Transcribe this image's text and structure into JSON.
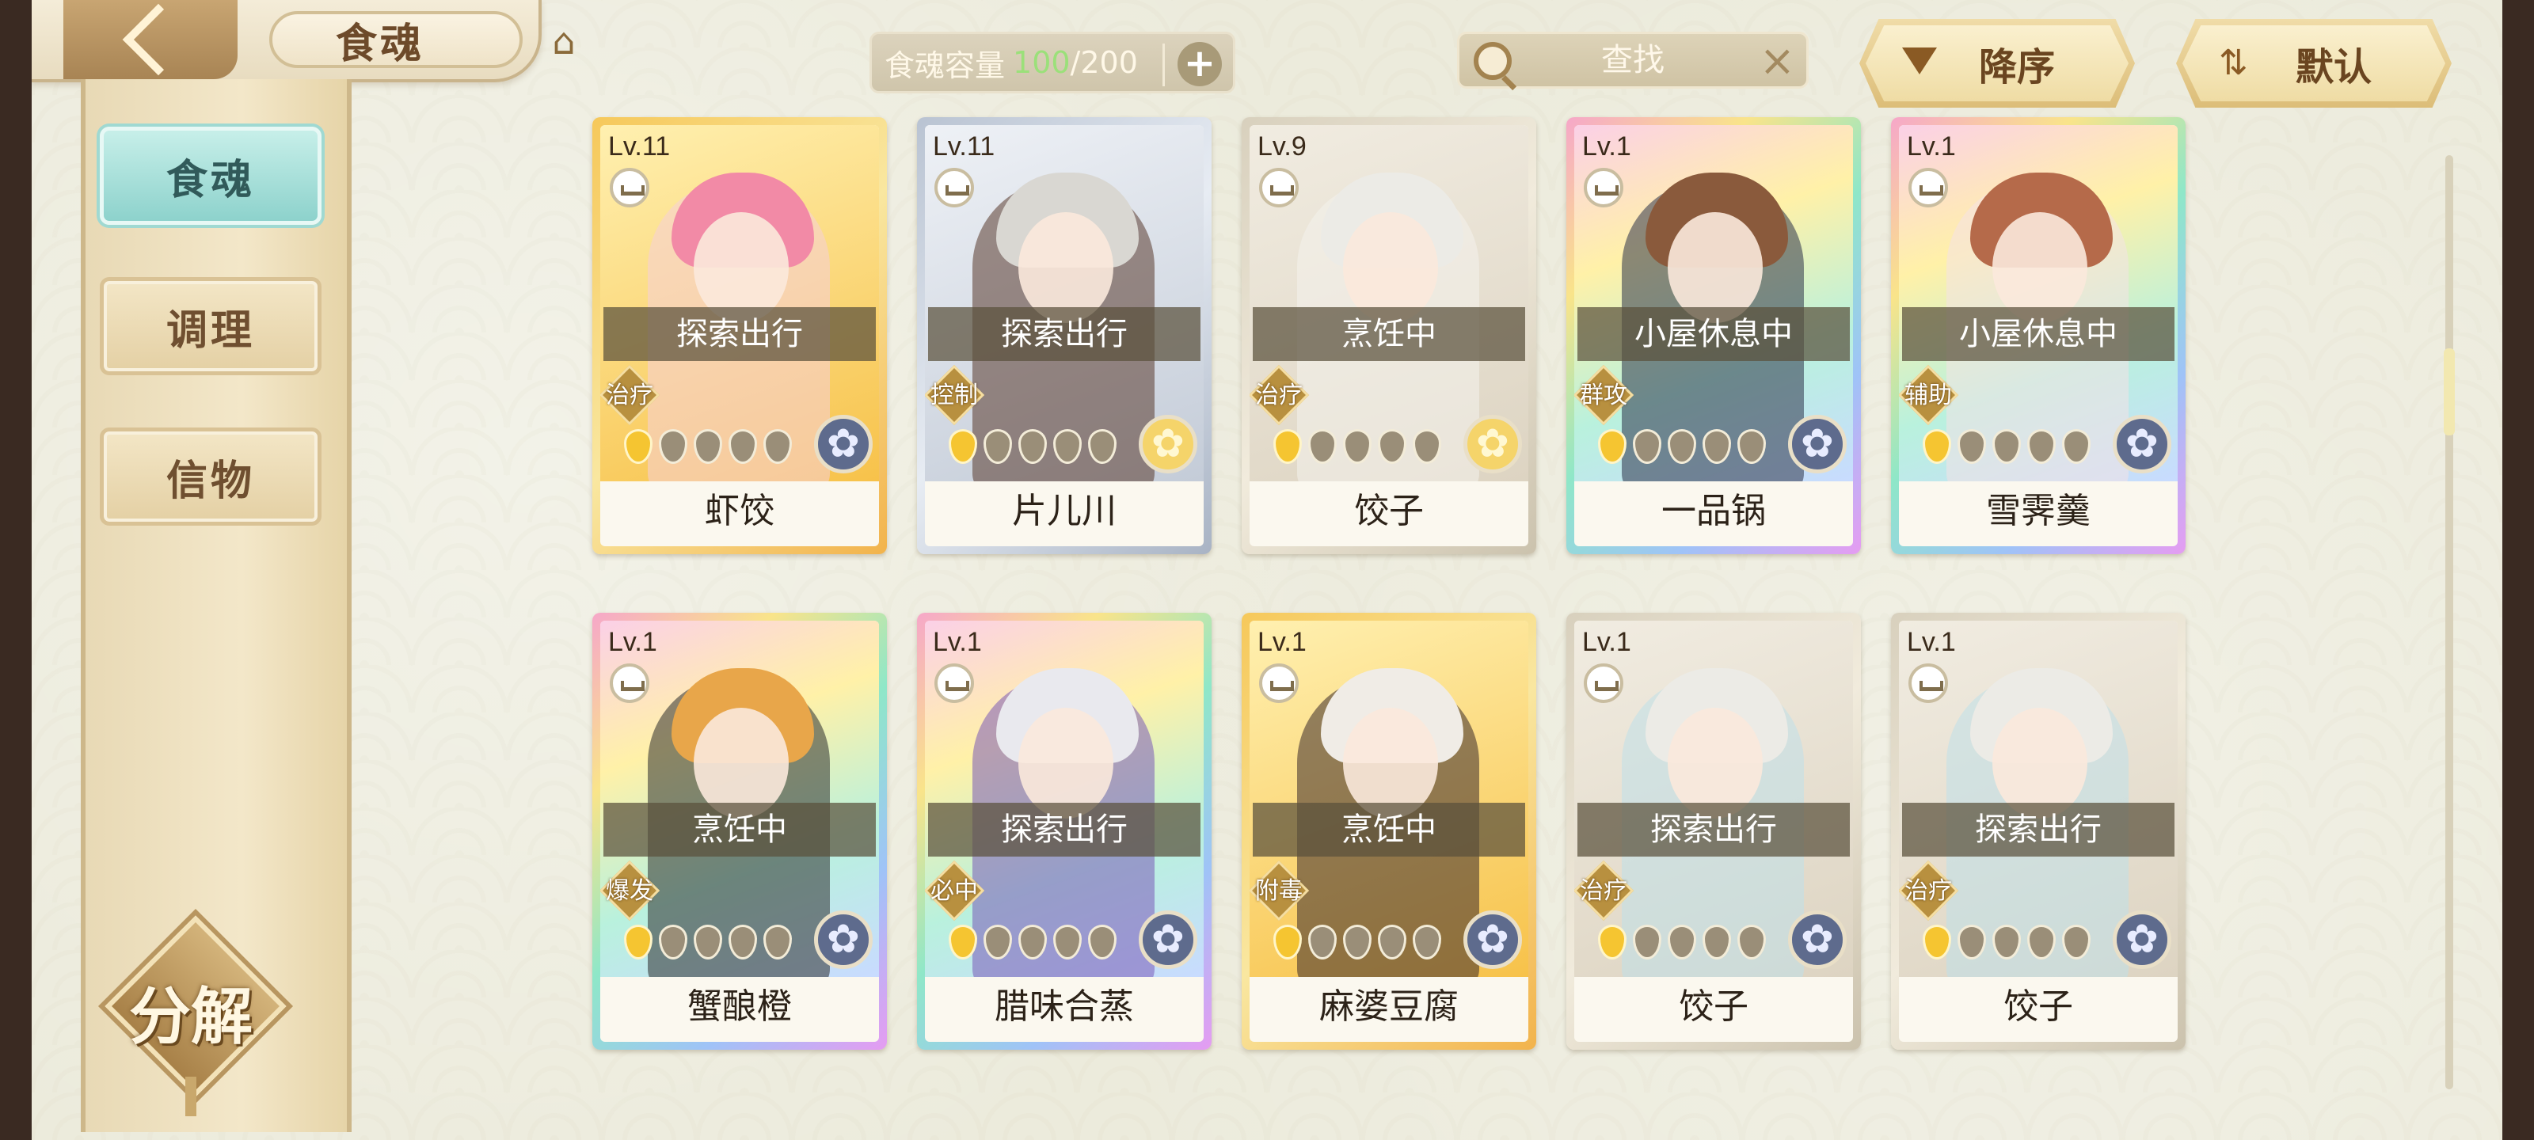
{
  "header": {
    "title": "食魂",
    "capacity_label": "食魂容量",
    "capacity_current": "100",
    "capacity_separator": "/",
    "capacity_max": "200",
    "search_label": "查找",
    "sort_order_label": "降序",
    "sort_mode_label": "默认"
  },
  "sidebar": {
    "items": [
      {
        "label": "食魂",
        "active": true
      },
      {
        "label": "调理",
        "active": false
      },
      {
        "label": "信物",
        "active": false
      }
    ],
    "decompose_label": "分解"
  },
  "cards": [
    {
      "level": "Lv.11",
      "status": "探索出行",
      "role": "治疗",
      "name": "虾饺",
      "stars": 1,
      "emblem": "blue",
      "frame": "gold",
      "hair": "#f28aa6",
      "outfit": "#f5d0d8"
    },
    {
      "level": "Lv.11",
      "status": "探索出行",
      "role": "控制",
      "name": "片儿川",
      "stars": 1,
      "emblem": "gold",
      "frame": "silver",
      "hair": "#d9d7d2",
      "outfit": "#5a3a2e"
    },
    {
      "level": "Lv.9",
      "status": "烹饪中",
      "role": "治疗",
      "name": "饺子",
      "stars": 1,
      "emblem": "gold",
      "frame": "plain",
      "hair": "#ecebe6",
      "outfit": "#f4f2ec"
    },
    {
      "level": "Lv.1",
      "status": "小屋休息中",
      "role": "群攻",
      "name": "一品锅",
      "stars": 1,
      "emblem": "blue",
      "frame": "rainbow",
      "hair": "#8a5a3c",
      "outfit": "#2c3248"
    },
    {
      "level": "Lv.1",
      "status": "小屋休息中",
      "role": "辅助",
      "name": "雪霁羹",
      "stars": 1,
      "emblem": "blue",
      "frame": "rainbow",
      "hair": "#b56a4a",
      "outfit": "#f4e2e6"
    },
    {
      "level": "Lv.1",
      "status": "烹饪中",
      "role": "爆发",
      "name": "蟹酿橙",
      "stars": 1,
      "emblem": "blue",
      "frame": "rainbow",
      "hair": "#e8a64a",
      "outfit": "#2b2b2b"
    },
    {
      "level": "Lv.1",
      "status": "探索出行",
      "role": "必中",
      "name": "腊味合蒸",
      "stars": 1,
      "emblem": "blue",
      "frame": "rainbow",
      "hair": "#e9e9ee",
      "outfit": "#7a5ab8"
    },
    {
      "level": "Lv.1",
      "status": "烹饪中",
      "role": "附毒",
      "name": "麻婆豆腐",
      "stars": 1,
      "emblem": "blue",
      "frame": "gold",
      "hair": "#f0ece6",
      "outfit": "#3a2a2a"
    },
    {
      "level": "Lv.1",
      "status": "探索出行",
      "role": "治疗",
      "name": "饺子",
      "stars": 1,
      "emblem": "blue",
      "frame": "plain",
      "hair": "#ecebe6",
      "outfit": "#bfe0ea"
    },
    {
      "level": "Lv.1",
      "status": "探索出行",
      "role": "治疗",
      "name": "饺子",
      "stars": 1,
      "emblem": "blue",
      "frame": "plain",
      "hair": "#ecebe6",
      "outfit": "#bfe0ea"
    }
  ]
}
